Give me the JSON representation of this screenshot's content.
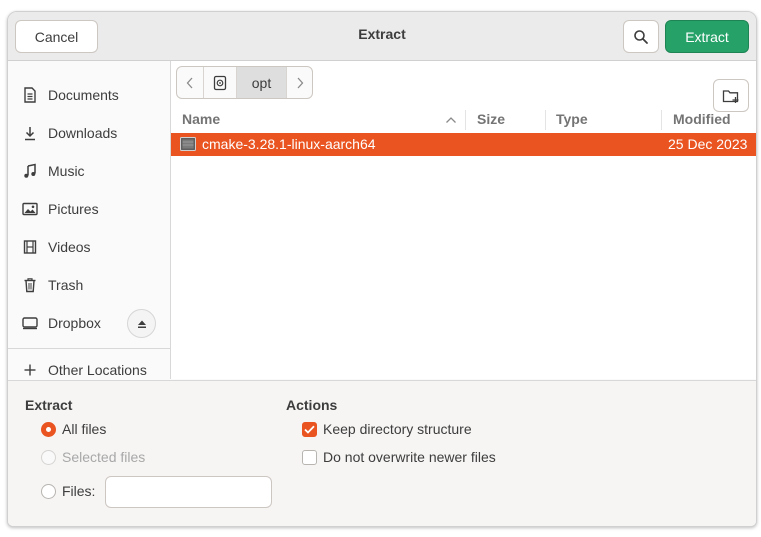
{
  "header": {
    "title": "Extract",
    "cancel_label": "Cancel",
    "extract_label": "Extract",
    "search_icon": "search-icon"
  },
  "sidebar": {
    "items": [
      {
        "label": "Documents",
        "icon": "document-icon"
      },
      {
        "label": "Downloads",
        "icon": "download-icon"
      },
      {
        "label": "Music",
        "icon": "music-icon"
      },
      {
        "label": "Pictures",
        "icon": "picture-icon"
      },
      {
        "label": "Videos",
        "icon": "video-icon"
      },
      {
        "label": "Trash",
        "icon": "trash-icon"
      },
      {
        "label": "Dropbox",
        "icon": "drive-icon"
      }
    ],
    "other_locations_label": "Other Locations"
  },
  "pathbar": {
    "current": "opt"
  },
  "columns": {
    "name": "Name",
    "size": "Size",
    "type": "Type",
    "modified": "Modified"
  },
  "files": [
    {
      "name": "cmake-3.28.1-linux-aarch64",
      "size": "",
      "type": "",
      "modified": "25 Dec 2023",
      "selected": true
    }
  ],
  "extract_section": {
    "title": "Extract",
    "all_files": "All files",
    "selected_files": "Selected files",
    "files_label": "Files:",
    "files_value": "",
    "selected_option": "All files"
  },
  "actions_section": {
    "title": "Actions",
    "keep_structure": "Keep directory structure",
    "keep_structure_checked": true,
    "no_overwrite": "Do not overwrite newer files",
    "no_overwrite_checked": false
  },
  "colors": {
    "accent": "#e95420",
    "extract_button": "#26a269"
  }
}
